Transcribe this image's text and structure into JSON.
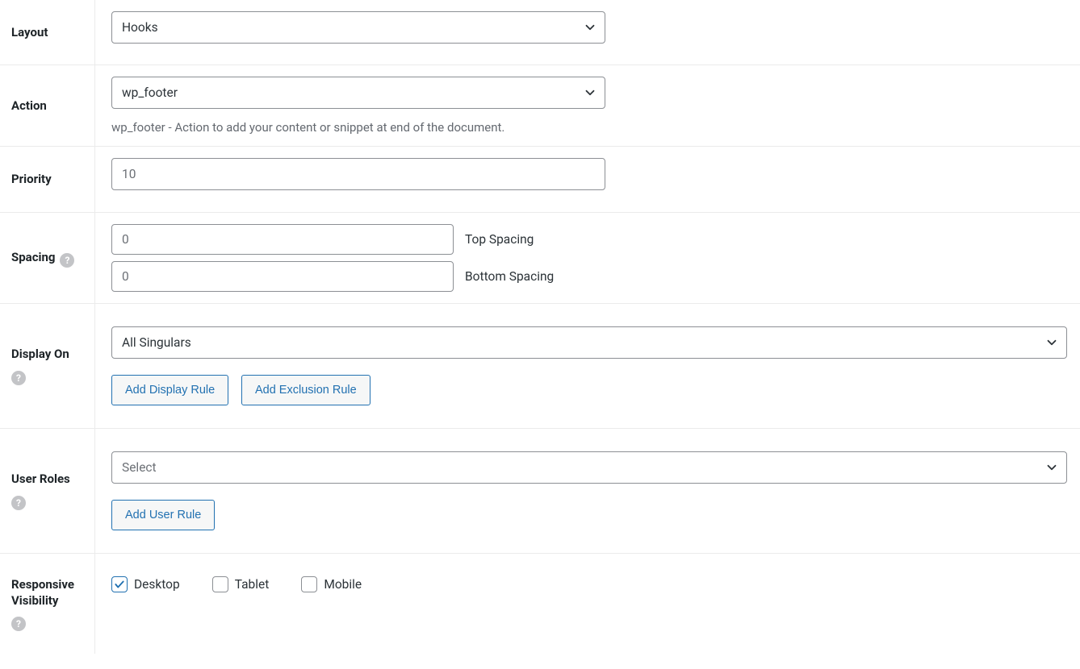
{
  "labels": {
    "layout": "Layout",
    "action": "Action",
    "priority": "Priority",
    "spacing": "Spacing",
    "display_on": "Display On",
    "user_roles": "User Roles",
    "responsive_visibility": "Responsive Visibility"
  },
  "layout": {
    "value": "Hooks"
  },
  "action": {
    "value": "wp_footer",
    "description": "wp_footer - Action to add your content or snippet at end of the document."
  },
  "priority": {
    "value": "10"
  },
  "spacing": {
    "top_value": "0",
    "top_label": "Top Spacing",
    "bottom_value": "0",
    "bottom_label": "Bottom Spacing"
  },
  "display_on": {
    "value": "All Singulars",
    "add_display_rule": "Add Display Rule",
    "add_exclusion_rule": "Add Exclusion Rule"
  },
  "user_roles": {
    "value": "Select",
    "add_user_rule": "Add User Rule"
  },
  "responsive": {
    "desktop": {
      "label": "Desktop",
      "checked": true
    },
    "tablet": {
      "label": "Tablet",
      "checked": false
    },
    "mobile": {
      "label": "Mobile",
      "checked": false
    }
  }
}
